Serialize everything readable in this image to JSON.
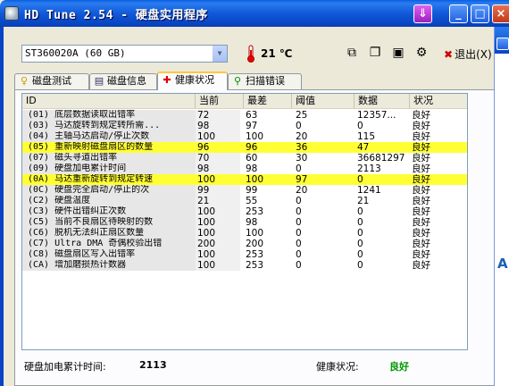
{
  "window": {
    "title": "HD Tune 2.54 - 硬盘实用程序",
    "download_icon": "arrow-down-icon",
    "min_glyph": "_",
    "max_glyph": "□",
    "close_glyph": "×"
  },
  "toolbar": {
    "drive": "ST360020A (60 GB)",
    "temperature": "21 ℃",
    "exit_label": "退出(X)"
  },
  "tabs": [
    {
      "label": "磁盘测试",
      "icon": "lightbulb-icon",
      "glyph": "♀"
    },
    {
      "label": "磁盘信息",
      "icon": "disk-icon",
      "glyph": "▤"
    },
    {
      "label": "健康状况",
      "icon": "health-cross-icon",
      "glyph": "✚"
    },
    {
      "label": "扫描错误",
      "icon": "magnifier-icon",
      "glyph": "🔍"
    }
  ],
  "table": {
    "columns": [
      "ID",
      "当前",
      "最差",
      "阈值",
      "数据",
      "状况"
    ],
    "rows": [
      {
        "id": "(01) 底层数据读取出错率",
        "cur": "72",
        "worst": "63",
        "th": "25",
        "data": "12357...",
        "status": "良好",
        "hl": false
      },
      {
        "id": "(03) 马达旋转到规定转所需...",
        "cur": "98",
        "worst": "97",
        "th": "0",
        "data": "0",
        "status": "良好",
        "hl": false
      },
      {
        "id": "(04) 主轴马达启动/停止次数",
        "cur": "100",
        "worst": "100",
        "th": "20",
        "data": "115",
        "status": "良好",
        "hl": false
      },
      {
        "id": "(05) 重新映射磁盘扇区的数量",
        "cur": "96",
        "worst": "96",
        "th": "36",
        "data": "47",
        "status": "良好",
        "hl": true
      },
      {
        "id": "(07) 磁头寻道出错率",
        "cur": "70",
        "worst": "60",
        "th": "30",
        "data": "36681297",
        "status": "良好",
        "hl": false
      },
      {
        "id": "(09) 硬盘加电累计时间",
        "cur": "98",
        "worst": "98",
        "th": "0",
        "data": "2113",
        "status": "良好",
        "hl": false
      },
      {
        "id": "(0A) 马达重新旋转到规定转速",
        "cur": "100",
        "worst": "100",
        "th": "97",
        "data": "0",
        "status": "良好",
        "hl": true
      },
      {
        "id": "(0C) 硬盘完全启动/停止的次",
        "cur": "99",
        "worst": "99",
        "th": "20",
        "data": "1241",
        "status": "良好",
        "hl": false
      },
      {
        "id": "(C2) 硬盘温度",
        "cur": "21",
        "worst": "55",
        "th": "0",
        "data": "21",
        "status": "良好",
        "hl": false
      },
      {
        "id": "(C3) 硬件出错纠正次数",
        "cur": "100",
        "worst": "253",
        "th": "0",
        "data": "0",
        "status": "良好",
        "hl": false
      },
      {
        "id": "(C5) 当前不良扇区待映射的数",
        "cur": "100",
        "worst": "98",
        "th": "0",
        "data": "0",
        "status": "良好",
        "hl": false
      },
      {
        "id": "(C6) 脱机无法纠正扇区数量",
        "cur": "100",
        "worst": "100",
        "th": "0",
        "data": "0",
        "status": "良好",
        "hl": false
      },
      {
        "id": "(C7) Ultra DMA 奇偶校验出错",
        "cur": "200",
        "worst": "200",
        "th": "0",
        "data": "0",
        "status": "良好",
        "hl": false
      },
      {
        "id": "(C8) 磁盘扇区写入出错率",
        "cur": "100",
        "worst": "253",
        "th": "0",
        "data": "0",
        "status": "良好",
        "hl": false
      },
      {
        "id": "(CA) 增加磨损热计数器",
        "cur": "100",
        "worst": "253",
        "th": "0",
        "data": "0",
        "status": "良好",
        "hl": false
      }
    ]
  },
  "footer": {
    "power_on_label": "硬盘加电累计时间:",
    "power_on_value": "2113",
    "health_label": "健康状况:",
    "health_value": "良好"
  },
  "side_window": {
    "letter": "A"
  },
  "colors": {
    "highlight": "#ffff33",
    "good": "#009900",
    "titlebar": "#0a5ee0"
  }
}
